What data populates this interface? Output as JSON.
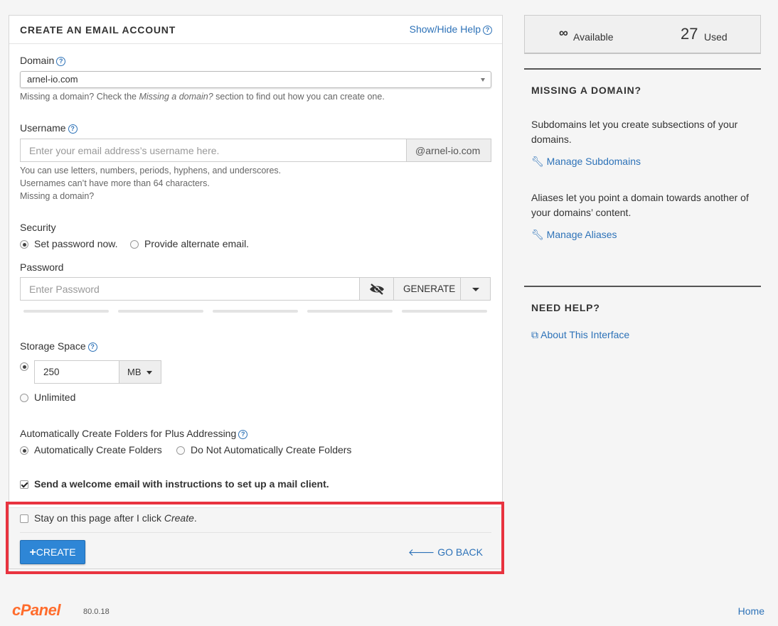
{
  "panel": {
    "title": "CREATE AN EMAIL ACCOUNT",
    "show_hide_help": "Show/Hide Help"
  },
  "domain": {
    "label": "Domain",
    "selected": "arnel-io.com",
    "help_prefix": "Missing a domain? Check the ",
    "help_italic": "Missing a domain?",
    "help_suffix": " section to find out how you can create one."
  },
  "username": {
    "label": "Username",
    "placeholder": "Enter your email address’s username here.",
    "suffix": "@arnel-io.com",
    "help_line1": "You can use letters, numbers, periods, hyphens, and underscores.",
    "help_line2": "Usernames can’t have more than 64 characters.",
    "missing_link": "Missing a domain?"
  },
  "security": {
    "label": "Security",
    "options": [
      "Set password now.",
      "Provide alternate email."
    ],
    "selected_index": 0
  },
  "password": {
    "label": "Password",
    "placeholder": "Enter Password",
    "generate_label": "GENERATE",
    "strength_segments": 5
  },
  "storage": {
    "label": "Storage Space",
    "value": "250",
    "unit": "MB",
    "unlimited_label": "Unlimited",
    "selected": "value"
  },
  "plus_addressing": {
    "label": "Automatically Create Folders for Plus Addressing",
    "options": [
      "Automatically Create Folders",
      "Do Not Automatically Create Folders"
    ],
    "selected_index": 0
  },
  "welcome_email": {
    "label": "Send a welcome email with instructions to set up a mail client.",
    "checked": true
  },
  "stay": {
    "label_prefix": "Stay on this page after I click ",
    "label_italic": "Create",
    "label_suffix": ".",
    "checked": false
  },
  "actions": {
    "create_label": "CREATE",
    "go_back_label": "GO BACK"
  },
  "stats": {
    "available_symbol": "∞",
    "available_label": "Available",
    "used_count": "27",
    "used_label": "Used"
  },
  "missing_domain": {
    "title": "MISSING A DOMAIN?",
    "subdomains_text": "Subdomains let you create subsections of your domains.",
    "subdomains_link": "Manage Subdomains",
    "aliases_text": "Aliases let you point a domain towards another of your domains’ content.",
    "aliases_link": "Manage Aliases"
  },
  "need_help": {
    "title": "NEED HELP?",
    "link": "About This Interface"
  },
  "footer": {
    "brand": "cPanel",
    "version": "80.0.18",
    "home_link": "Home"
  },
  "colors": {
    "accent": "#2d72b8",
    "primary_button": "#2e86d6",
    "highlight_border": "#e8333f",
    "brand_orange": "#ff6c2c"
  }
}
